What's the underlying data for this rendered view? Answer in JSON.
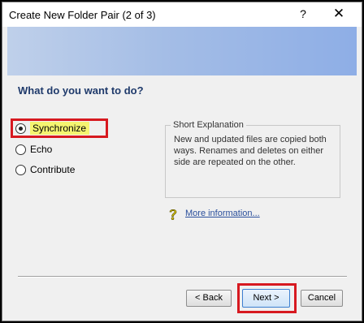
{
  "window": {
    "title": "Create New Folder Pair (2 of 3)",
    "help_label": "?",
    "close_label": "✕"
  },
  "colors": {
    "banner_left": "#bfd0ea",
    "banner_right": "#8eaee6",
    "heading": "#1f3a6b",
    "highlight": "#d71920",
    "synchronize_highlight": "#f5f570",
    "link": "#2a4f9c"
  },
  "main": {
    "heading": "What do you want to do?",
    "options": [
      {
        "label": "Synchronize",
        "selected": true
      },
      {
        "label": "Echo",
        "selected": false
      },
      {
        "label": "Contribute",
        "selected": false
      }
    ],
    "explanation": {
      "title": "Short Explanation",
      "text": "New and updated files are copied both ways. Renames and deletes on either side are repeated on the other."
    },
    "more_info_icon": "question-mark-icon",
    "more_info_label": "More information..."
  },
  "footer": {
    "back_label": "< Back",
    "next_label": "Next >",
    "cancel_label": "Cancel"
  }
}
